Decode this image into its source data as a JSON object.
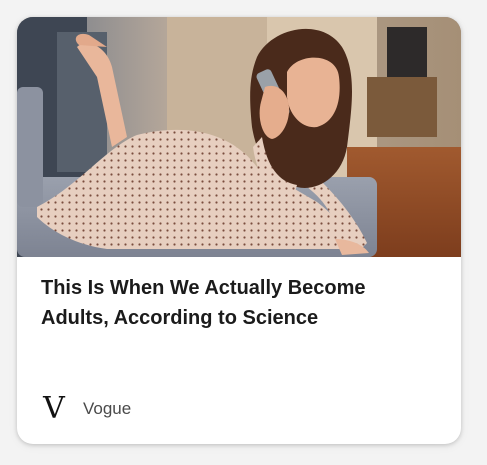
{
  "article": {
    "headline": "This Is When We Actually Become Adults, According to Science",
    "image_alt": "Woman in a dotted robe lying on a sofa, talking on a cordless phone"
  },
  "source": {
    "logo_letter": "V",
    "name": "Vogue"
  },
  "colors": {
    "card_background": "#ffffff",
    "page_background": "#f3f3f3",
    "headline_text": "#1b1b1b",
    "source_text": "#4a4a4a"
  }
}
